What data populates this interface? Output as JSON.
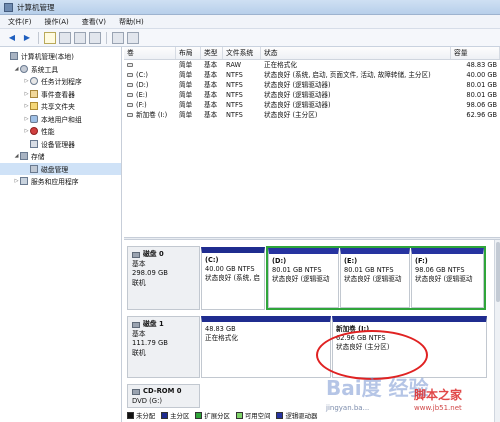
{
  "window": {
    "title": "计算机管理"
  },
  "menu": [
    "文件(F)",
    "操作(A)",
    "查看(V)",
    "帮助(H)"
  ],
  "tree": [
    {
      "label": "计算机管理(本地)",
      "icon": "computer-icon",
      "level": 0,
      "arrow": ""
    },
    {
      "label": "系统工具",
      "icon": "tools-icon",
      "level": 1,
      "arrow": "◢"
    },
    {
      "label": "任务计划程序",
      "icon": "clock-icon",
      "level": 2,
      "arrow": "▷"
    },
    {
      "label": "事件查看器",
      "icon": "event-viewer-icon",
      "level": 2,
      "arrow": "▷"
    },
    {
      "label": "共享文件夹",
      "icon": "shared-folder-icon",
      "level": 2,
      "arrow": "▷"
    },
    {
      "label": "本地用户和组",
      "icon": "users-icon",
      "level": 2,
      "arrow": "▷"
    },
    {
      "label": "性能",
      "icon": "performance-icon",
      "level": 2,
      "arrow": "▷"
    },
    {
      "label": "设备管理器",
      "icon": "device-manager-icon",
      "level": 2,
      "arrow": ""
    },
    {
      "label": "存储",
      "icon": "storage-icon",
      "level": 1,
      "arrow": "◢"
    },
    {
      "label": "磁盘管理",
      "icon": "disk-management-icon",
      "level": 2,
      "arrow": "",
      "selected": true
    },
    {
      "label": "服务和应用程序",
      "icon": "services-icon",
      "level": 1,
      "arrow": "▷"
    }
  ],
  "volume_table": {
    "headers": [
      "卷",
      "布局",
      "类型",
      "文件系统",
      "状态",
      "容量"
    ],
    "rows": [
      [
        "",
        "简单",
        "基本",
        "RAW",
        "正在格式化",
        "48.83 GB"
      ],
      [
        "(C:)",
        "简单",
        "基本",
        "NTFS",
        "状态良好 (系统, 启动, 页面文件, 活动, 故障转储, 主分区)",
        "40.00 GB"
      ],
      [
        "(D:)",
        "简单",
        "基本",
        "NTFS",
        "状态良好 (逻辑驱动器)",
        "80.01 GB"
      ],
      [
        "(E:)",
        "简单",
        "基本",
        "NTFS",
        "状态良好 (逻辑驱动器)",
        "80.01 GB"
      ],
      [
        "(F:)",
        "简单",
        "基本",
        "NTFS",
        "状态良好 (逻辑驱动器)",
        "98.06 GB"
      ],
      [
        "新加卷 (I:)",
        "简单",
        "基本",
        "NTFS",
        "状态良好 (主分区)",
        "62.96 GB"
      ]
    ]
  },
  "disks": [
    {
      "name": "磁盘 0",
      "type": "基本",
      "size": "298.09 GB",
      "status": "联机",
      "primary": {
        "label": "(C:)",
        "line1": "40.00 GB NTFS",
        "line2": "状态良好 (系统, 启"
      },
      "logical": [
        {
          "label": "(D:)",
          "line1": "80.01 GB NTFS",
          "line2": "状态良好 (逻辑驱动"
        },
        {
          "label": "(E:)",
          "line1": "80.01 GB NTFS",
          "line2": "状态良好 (逻辑驱动"
        },
        {
          "label": "(F:)",
          "line1": "98.06 GB NTFS",
          "line2": "状态良好 (逻辑驱动"
        }
      ]
    },
    {
      "name": "磁盘 1",
      "type": "基本",
      "size": "111.79 GB",
      "status": "联机",
      "parts": [
        {
          "label": "",
          "line1": "48.83 GB",
          "line2": "正在格式化"
        },
        {
          "label": "新加卷 (I:)",
          "line1": "62.96 GB NTFS",
          "line2": "状态良好 (主分区)"
        }
      ]
    },
    {
      "name": "CD-ROM 0",
      "type": "DVD (G:)"
    }
  ],
  "legend": [
    {
      "label": "未分配",
      "color": "#111111"
    },
    {
      "label": "主分区",
      "color": "#1f2c8f"
    },
    {
      "label": "扩展分区",
      "color": "#2fa53a"
    },
    {
      "label": "可用空间",
      "color": "#7fd46a"
    },
    {
      "label": "逻辑驱动器",
      "color": "#2633a0"
    }
  ],
  "watermark": {
    "brand": "Bai度 经验",
    "site_right": "脚本之家",
    "url_left": "jingyan.ba...",
    "url_right": "www.jb51.net"
  }
}
